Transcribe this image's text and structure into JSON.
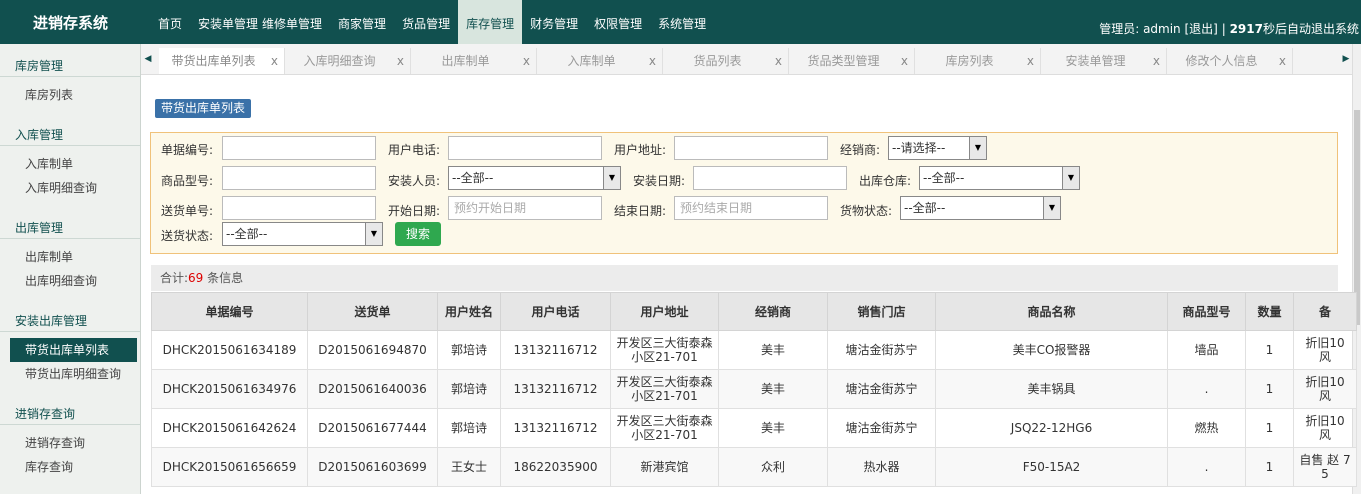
{
  "app_title": "进销存系统",
  "nav": [
    "首页",
    "安装单管理",
    "维修单管理",
    "商家管理",
    "货品管理",
    "库存管理",
    "财务管理",
    "权限管理",
    "系统管理"
  ],
  "user": {
    "prefix": "管理员:",
    "name": "admin",
    "logout": "[退出]",
    "sep": "|",
    "countdown": "2917",
    "countdown_suffix": "秒后自动退出系统"
  },
  "sidebar": {
    "groups": [
      {
        "title": "库房管理",
        "items": [
          "库房列表"
        ]
      },
      {
        "title": "入库管理",
        "items": [
          "入库制单",
          "入库明细查询"
        ]
      },
      {
        "title": "出库管理",
        "items": [
          "出库制单",
          "出库明细查询"
        ]
      },
      {
        "title": "安装出库管理",
        "items": [
          "带货出库单列表",
          "带货出库明细查询"
        ]
      },
      {
        "title": "进销存查询",
        "items": [
          "进销存查询",
          "库存查询"
        ]
      }
    ]
  },
  "tabs": [
    "带货出库单列表",
    "入库明细查询",
    "出库制单",
    "入库制单",
    "货品列表",
    "货品类型管理",
    "库房列表",
    "安装单管理",
    "修改个人信息"
  ],
  "tab_close": "x",
  "page_title": "带货出库单列表",
  "filter": {
    "doc_no": "单据编号:",
    "phone": "用户电话:",
    "address": "用户地址:",
    "dealer": "经销商:",
    "dealer_sel": "--请选择--",
    "model": "商品型号:",
    "installer": "安装人员:",
    "installer_sel": "--全部--",
    "install_date": "安装日期:",
    "warehouse": "出库仓库:",
    "warehouse_sel": "--全部--",
    "delivery_no": "送货单号:",
    "start_date": "开始日期:",
    "start_ph": "预约开始日期",
    "end_date": "结束日期:",
    "end_ph": "预约结束日期",
    "goods_status": "货物状态:",
    "goods_status_sel": "--全部--",
    "delivery_status": "送货状态:",
    "delivery_status_sel": "--全部--",
    "search": "搜索"
  },
  "summary": {
    "prefix": "合计:",
    "count": "69",
    "suffix": "条信息"
  },
  "table": {
    "headers": [
      "单据编号",
      "送货单",
      "用户姓名",
      "用户电话",
      "用户地址",
      "经销商",
      "销售门店",
      "商品名称",
      "商品型号",
      "数量",
      "备"
    ],
    "rows": [
      [
        "DHCK2015061634189",
        "D2015061694870",
        "郭培诗",
        "13132116712",
        "开发区三大街泰森小区21-701",
        "美丰",
        "塘沽金街苏宁",
        "美丰CO报警器",
        "墙品",
        "1",
        "折旧10 风"
      ],
      [
        "DHCK2015061634976",
        "D2015061640036",
        "郭培诗",
        "13132116712",
        "开发区三大街泰森小区21-701",
        "美丰",
        "塘沽金街苏宁",
        "美丰锅具",
        ".",
        "1",
        "折旧10 风"
      ],
      [
        "DHCK2015061642624",
        "D2015061677444",
        "郭培诗",
        "13132116712",
        "开发区三大街泰森小区21-701",
        "美丰",
        "塘沽金街苏宁",
        "JSQ22-12HG6",
        "燃热",
        "1",
        "折旧10 风"
      ],
      [
        "DHCK2015061656659",
        "D2015061603699",
        "王女士",
        "18622035900",
        "新港宾馆",
        "众利",
        "热水器",
        "F50-15A2",
        ".",
        "1",
        "自售 赵 75"
      ]
    ]
  }
}
